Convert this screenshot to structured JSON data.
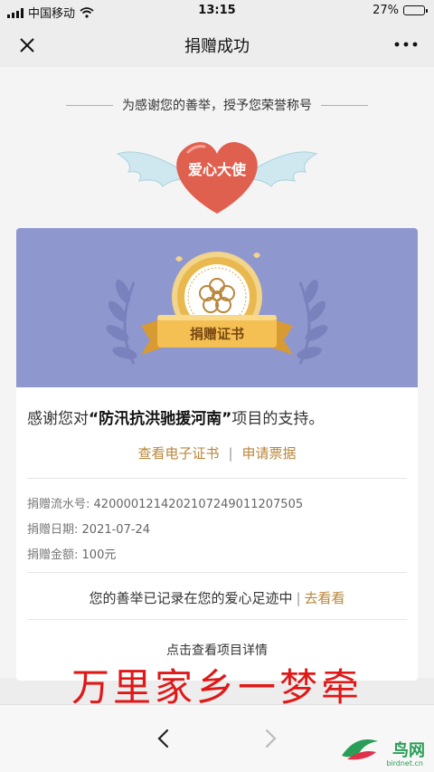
{
  "status_bar": {
    "carrier": "中国移动",
    "time": "13:15",
    "battery": "27%",
    "battery_level": 0.27
  },
  "nav": {
    "title": "捐赠成功",
    "close_icon": "close-icon",
    "more_icon": "more-icon"
  },
  "honor": {
    "caption": "为感谢您的善举，授予您荣誉称号",
    "title": "爱心大使"
  },
  "certificate": {
    "ribbon": "捐赠证书"
  },
  "thanks": {
    "prefix": "感谢您对",
    "project": "“防汛抗洪驰援河南”",
    "suffix": "项目的支持。"
  },
  "links": {
    "view_cert": "查看电子证书",
    "separator": "|",
    "apply_receipt": "申请票据"
  },
  "donation": {
    "serial_label": "捐赠流水号:",
    "serial_value": "4200001214202107249011207505",
    "date_label": "捐赠日期:",
    "date_value": "2021-07-24",
    "amount_label": "捐赠金额:",
    "amount_value": "100元"
  },
  "footprint": {
    "text": "您的善举已记录在您的爱心足迹中",
    "separator": "|",
    "link": "去看看"
  },
  "detail_link": "点击查看项目详情",
  "overlay_caption": "万里家乡一梦牵",
  "watermark": {
    "name": "鸟网",
    "domain": "birdnet.cn"
  },
  "colors": {
    "accent": "#b8863a",
    "heart": "#e0604f",
    "banner": "#8f97cf",
    "overlay": "#e01818"
  }
}
